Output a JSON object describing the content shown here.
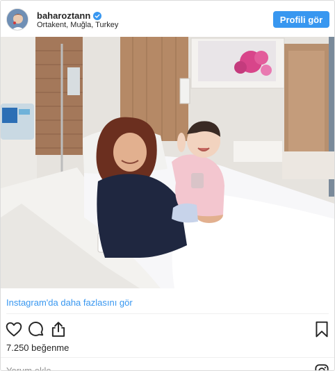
{
  "post": {
    "username": "baharoztann",
    "location": "Ortakent, Muğla, Turkey",
    "profile_button": "Profili gör",
    "more_link": "Instagram'da daha fazlasını gör",
    "likes": "7.250 beğenme",
    "comment_placeholder": "Yorum ekle..."
  },
  "icons": {
    "verified": "verified-badge-icon",
    "like": "heart-icon",
    "comment": "comment-bubble-icon",
    "share": "share-icon",
    "save": "bookmark-icon",
    "brand": "instagram-logo-icon"
  },
  "colors": {
    "accent": "#3897f0",
    "text": "#262626",
    "muted": "#8e8e8e",
    "border": "#dbdbdb"
  }
}
